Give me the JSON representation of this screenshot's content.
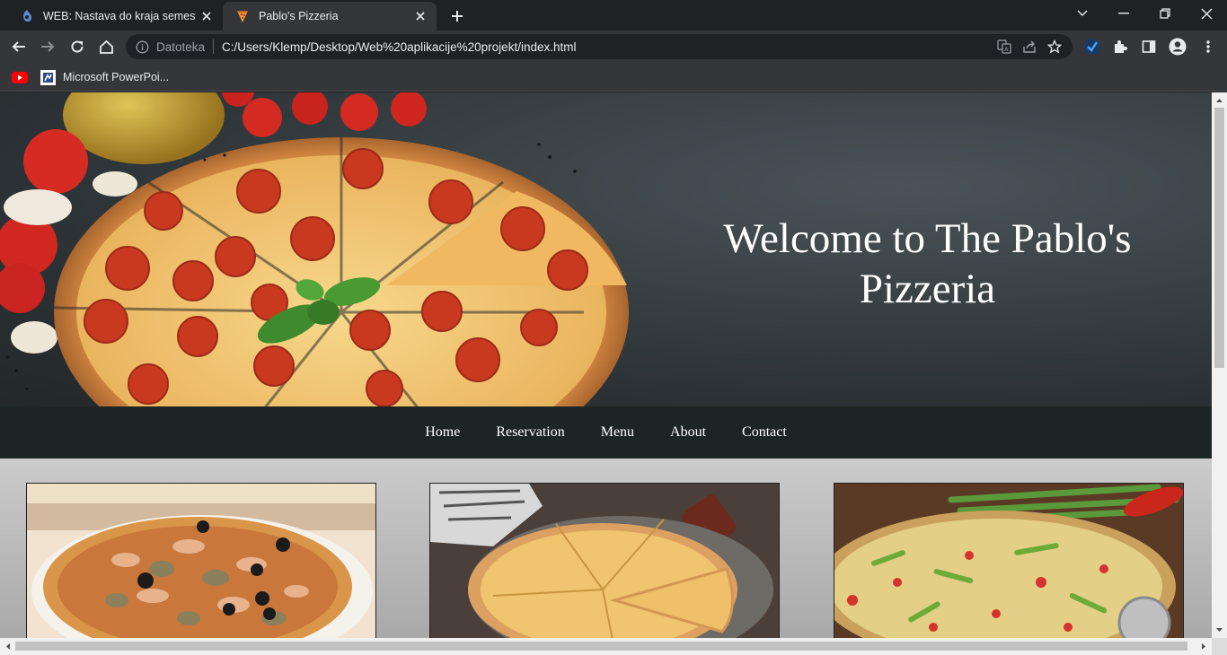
{
  "browser": {
    "tabs": [
      {
        "title": "WEB: Nastava do kraja semestra, ",
        "active": false,
        "favicon": "moodle-icon"
      },
      {
        "title": "Pablo's Pizzeria",
        "active": true,
        "favicon": "pizza-icon"
      }
    ],
    "address": {
      "scheme_label": "Datoteka",
      "url": "C:/Users/Klemp/Desktop/Web%20aplikacije%20projekt/index.html"
    },
    "bookmarks": [
      {
        "label": "",
        "icon": "youtube-icon"
      },
      {
        "label": "Microsoft PowerPoi...",
        "icon": "powerpoint-icon"
      }
    ]
  },
  "page": {
    "hero": {
      "title": "Welcome to The Pablo's Pizzeria"
    },
    "nav": [
      "Home",
      "Reservation",
      "Menu",
      "About",
      "Contact"
    ]
  },
  "colors": {
    "chrome_dark": "#202124",
    "chrome_toolbar": "#35363a",
    "nav_bg": "#1c2523",
    "hero_bg": "#2b3134"
  }
}
